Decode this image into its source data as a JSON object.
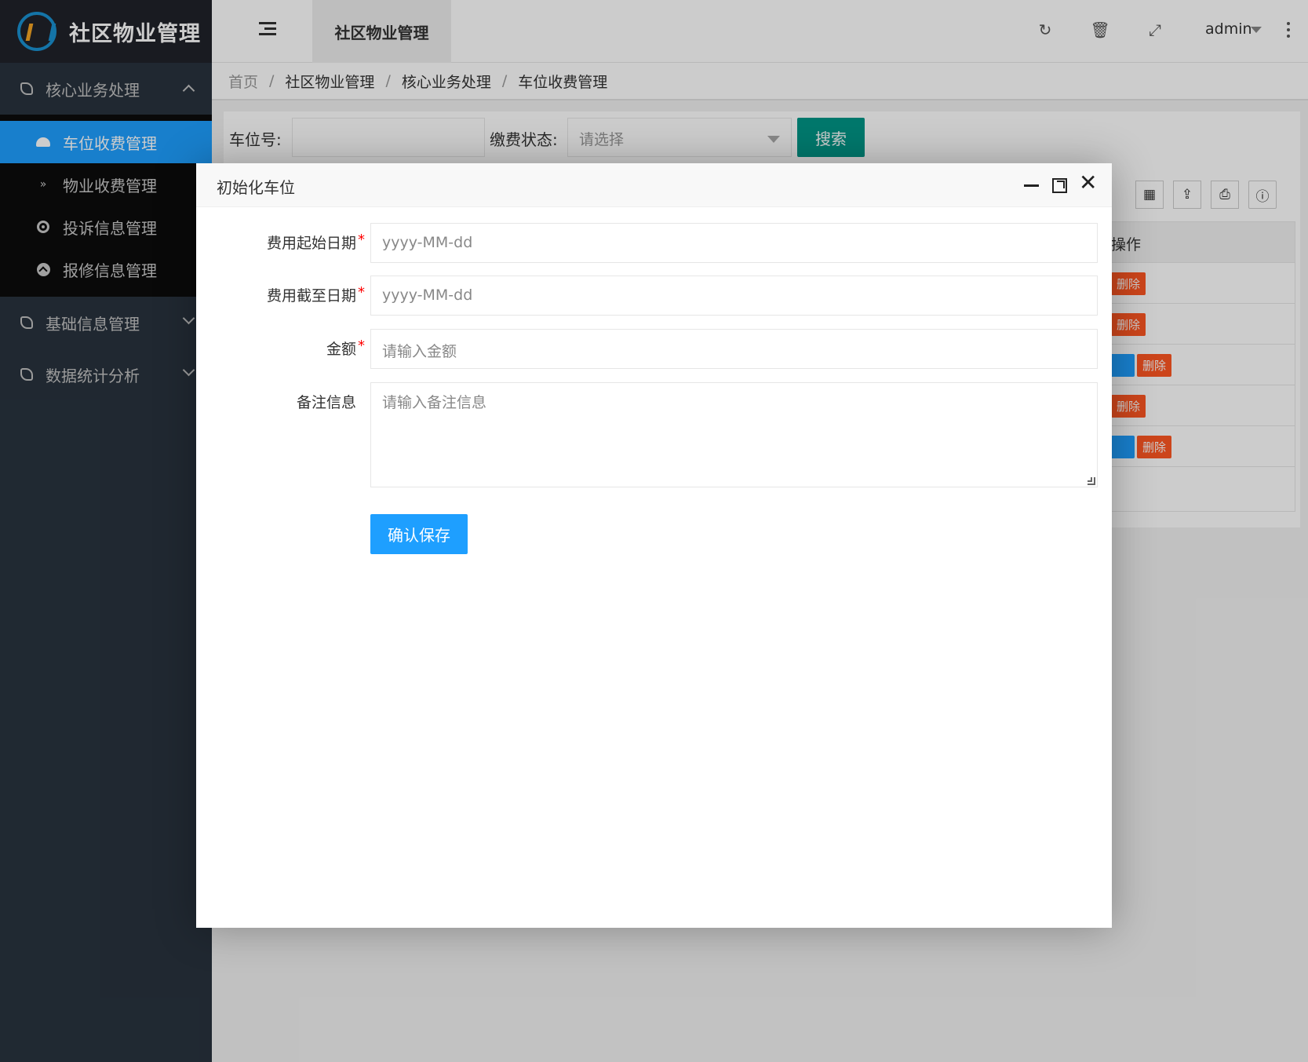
{
  "app": {
    "title": "社区物业管理"
  },
  "sidebar": {
    "groups": [
      {
        "label": "核心业务处理",
        "expanded": true,
        "items": [
          {
            "label": "车位收费管理",
            "icon": "dashboard-icon",
            "active": true
          },
          {
            "label": "物业收费管理",
            "icon": "double-chevron-down-icon"
          },
          {
            "label": "投诉信息管理",
            "icon": "target-circle-icon"
          },
          {
            "label": "报修信息管理",
            "icon": "up-arrow-circle-icon"
          }
        ]
      },
      {
        "label": "基础信息管理",
        "expanded": false
      },
      {
        "label": "数据统计分析",
        "expanded": false
      }
    ]
  },
  "header": {
    "tab": "社区物业管理",
    "user": "admin",
    "icons": [
      "refresh-icon",
      "trash-icon",
      "fullscreen-icon",
      "more-icon"
    ]
  },
  "breadcrumb": [
    "首页",
    "社区物业管理",
    "核心业务处理",
    "车位收费管理"
  ],
  "search": {
    "spot_label": "车位号:",
    "spot_value": "",
    "status_label": "缴费状态:",
    "status_placeholder": "请选择",
    "button": "搜索"
  },
  "table": {
    "op_header": "操作",
    "delete_label": "删除",
    "tools": [
      "columns-icon",
      "export-icon",
      "print-icon",
      "info-icon"
    ]
  },
  "modal": {
    "title": "初始化车位",
    "fields": {
      "start_label": "费用起始日期",
      "start_placeholder": "yyyy-MM-dd",
      "end_label": "费用截至日期",
      "end_placeholder": "yyyy-MM-dd",
      "amount_label": "金额",
      "amount_placeholder": "请输入金额",
      "note_label": "备注信息",
      "note_placeholder": "请输入备注信息"
    },
    "required_mark": "*",
    "save_button": "确认保存"
  },
  "colors": {
    "sidebar_bg": "#28333e",
    "active": "#1e9fff",
    "search_btn": "#009688",
    "delete_btn": "#ff5722"
  }
}
